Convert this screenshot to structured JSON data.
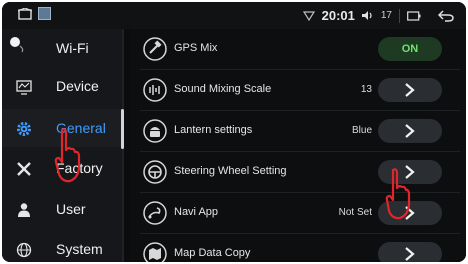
{
  "status_bar": {
    "time": "20:01",
    "volume": "17",
    "icons": [
      "home-icon",
      "gallery-icon",
      "wifi-signal-icon",
      "volume-icon",
      "back-icon"
    ]
  },
  "sidebar": {
    "items": [
      {
        "label": "Wi-Fi",
        "icon": "wifi-icon"
      },
      {
        "label": "Device",
        "icon": "monitor-icon"
      },
      {
        "label": "General",
        "icon": "gear-icon",
        "active": true
      },
      {
        "label": "Factory",
        "icon": "tools-icon"
      },
      {
        "label": "User",
        "icon": "user-icon"
      },
      {
        "label": "System",
        "icon": "globe-icon"
      }
    ]
  },
  "settings": {
    "rows": [
      {
        "label": "GPS Mix",
        "value": "",
        "control": "toggle",
        "toggle_label": "ON",
        "icon": "satellite-icon"
      },
      {
        "label": "Sound Mixing Scale",
        "value": "13",
        "control": "chevron",
        "icon": "equalizer-icon"
      },
      {
        "label": "Lantern settings",
        "value": "Blue",
        "control": "chevron",
        "icon": "android-icon"
      },
      {
        "label": "Steering Wheel Setting",
        "value": "",
        "control": "chevron",
        "icon": "steering-wheel-icon"
      },
      {
        "label": "Navi App",
        "value": "Not Set",
        "control": "chevron",
        "icon": "navigation-icon"
      },
      {
        "label": "Map Data Copy",
        "value": "",
        "control": "chevron",
        "icon": "map-icon"
      }
    ]
  },
  "colors": {
    "active_accent": "#3f9dff",
    "toggle_on": "#6de36d",
    "annotation": "#e0262b"
  }
}
